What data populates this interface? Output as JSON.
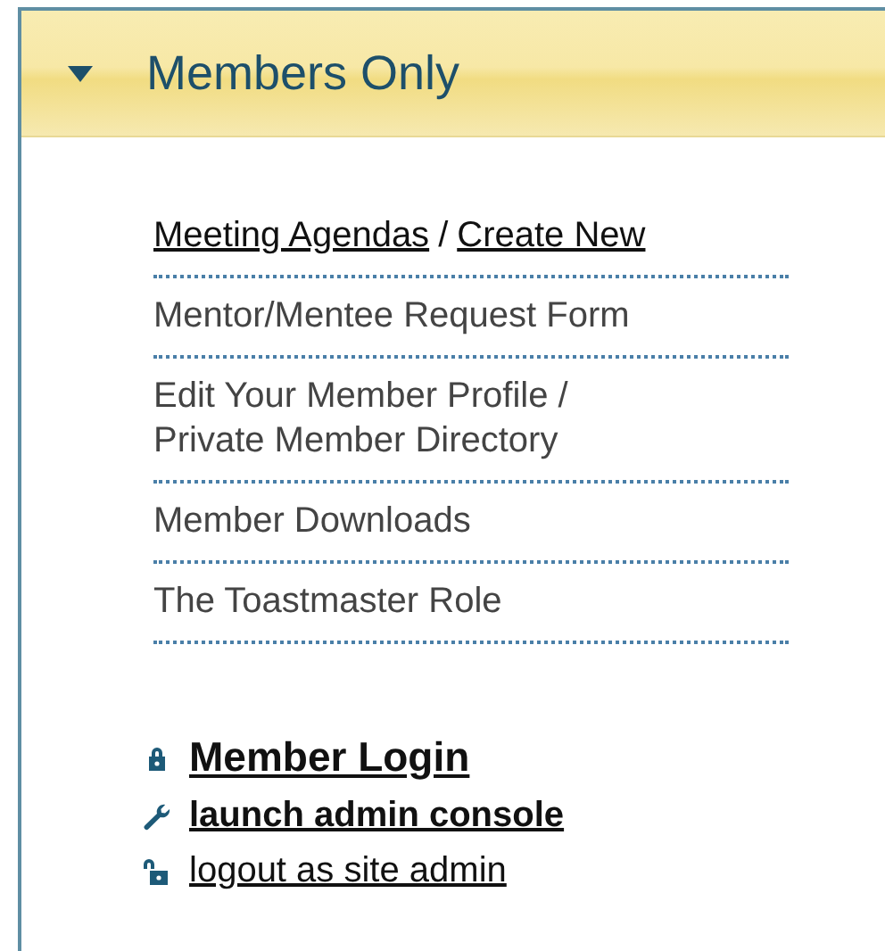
{
  "panel": {
    "title": "Members Only",
    "expanded": true
  },
  "menu": [
    {
      "kind": "links",
      "links": [
        "Meeting Agendas",
        "Create New"
      ],
      "separator": "/"
    },
    {
      "kind": "text",
      "text": "Mentor/Mentee Request Form"
    },
    {
      "kind": "text",
      "text": "Edit Your Member Profile /\nPrivate Member Directory"
    },
    {
      "kind": "text",
      "text": "Member Downloads"
    },
    {
      "kind": "text",
      "text": "The Toastmaster Role"
    }
  ],
  "admin_links": [
    {
      "kind": "login",
      "label": "Member Login"
    },
    {
      "kind": "console",
      "label": "launch admin console"
    },
    {
      "kind": "logout",
      "label": "logout as site admin"
    }
  ]
}
